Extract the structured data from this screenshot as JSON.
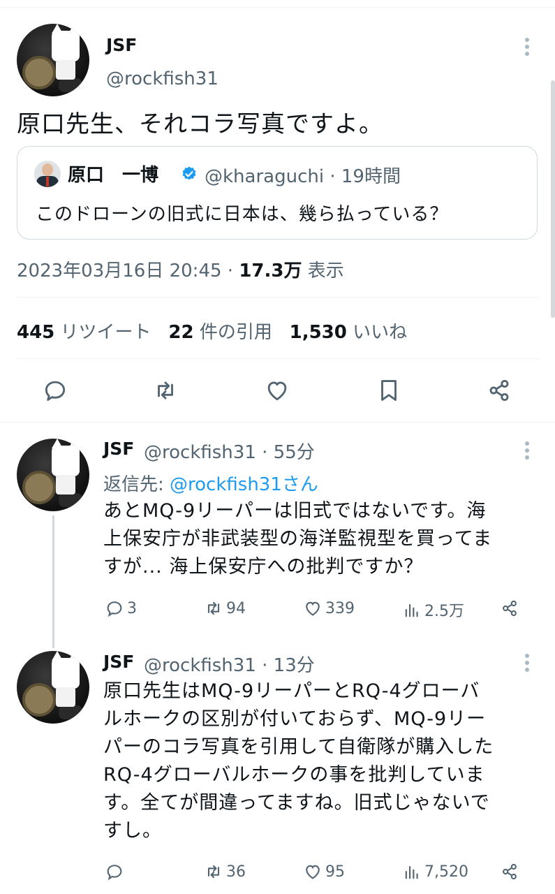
{
  "main_tweet": {
    "name": "JSF",
    "handle": "@rockfish31",
    "text": "原口先生、それコラ写真ですよ。",
    "quote": {
      "name": "原口　一博",
      "handle_time": "@kharaguchi · 19時間",
      "text": "このドローンの旧式に日本は、幾ら払っている？"
    },
    "timestamp": "2023年03月16日 20:45 · ",
    "views_count": "17.3万",
    "views_label": " 表示",
    "stats": {
      "retweets_count": "445",
      "retweets_label": "リツイート",
      "quotes_count": "22",
      "quotes_label": "件の引用",
      "likes_count": "1,530",
      "likes_label": "いいね"
    }
  },
  "replies": [
    {
      "name": "JSF",
      "handle_time": "@rockfish31 · 55分",
      "reply_to_prefix": "返信先: ",
      "reply_to_handle": "@rockfish31さん",
      "text": "あとMQ-9リーパーは旧式ではないです。海\n上保安庁が非武装型の海洋監視型を買ってま\nすが... 海上保安庁への批判ですか？",
      "replies": "3",
      "retweets": "94",
      "likes": "339",
      "views": "2.5万"
    },
    {
      "name": "JSF",
      "handle_time": "@rockfish31 · 13分",
      "text": "原口先生はMQ-9リーパーとRQ-4グローバ\nルホークの区別が付いておらず、MQ-9リー\nパーのコラ写真を引用して自衛隊が購入した\nRQ-4グローバルホークの事を批判していま\nす。全てが間違ってますね。旧式じゃないで\nすし。",
      "replies": "",
      "retweets": "36",
      "likes": "95",
      "views": "7,520"
    }
  ],
  "colors": {
    "text": "#0f1419",
    "secondary": "#536471",
    "link": "#1d9bf0",
    "border": "#cfd9de"
  }
}
